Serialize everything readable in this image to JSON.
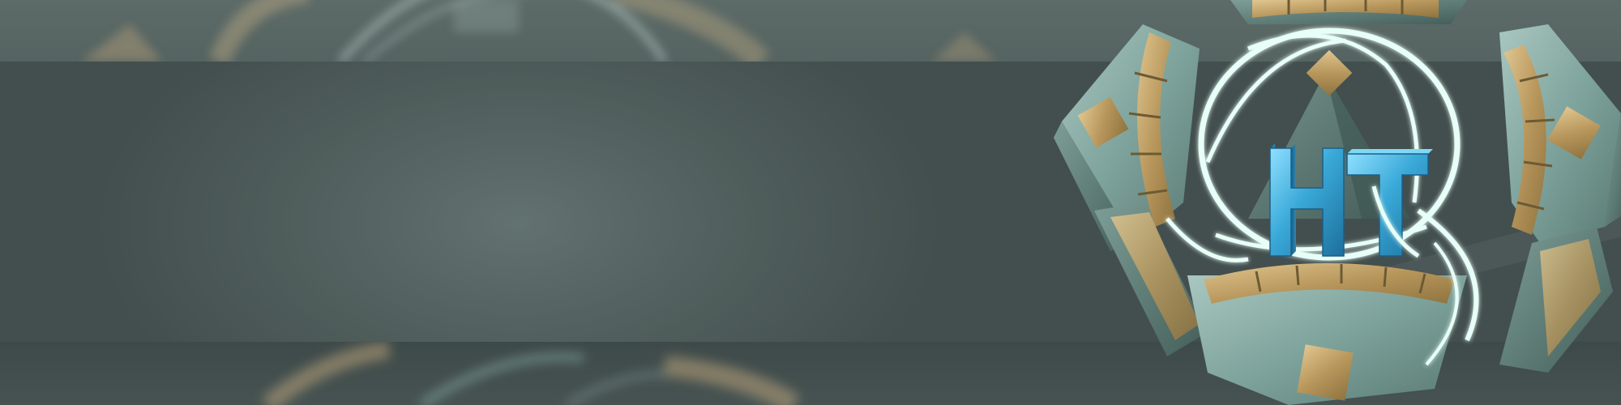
{
  "logo": {
    "monogram": "HT",
    "icon": "ornate-ring-emblem-icon"
  },
  "colors": {
    "background": "#4f5d5b",
    "band_top": "#5a6866",
    "band_bottom": "#414d4c",
    "gold": "#c9a86a",
    "teal_metal": "#8fb3ad",
    "glow": "#e8fff8",
    "monogram_blue": "#3aa9d8"
  }
}
